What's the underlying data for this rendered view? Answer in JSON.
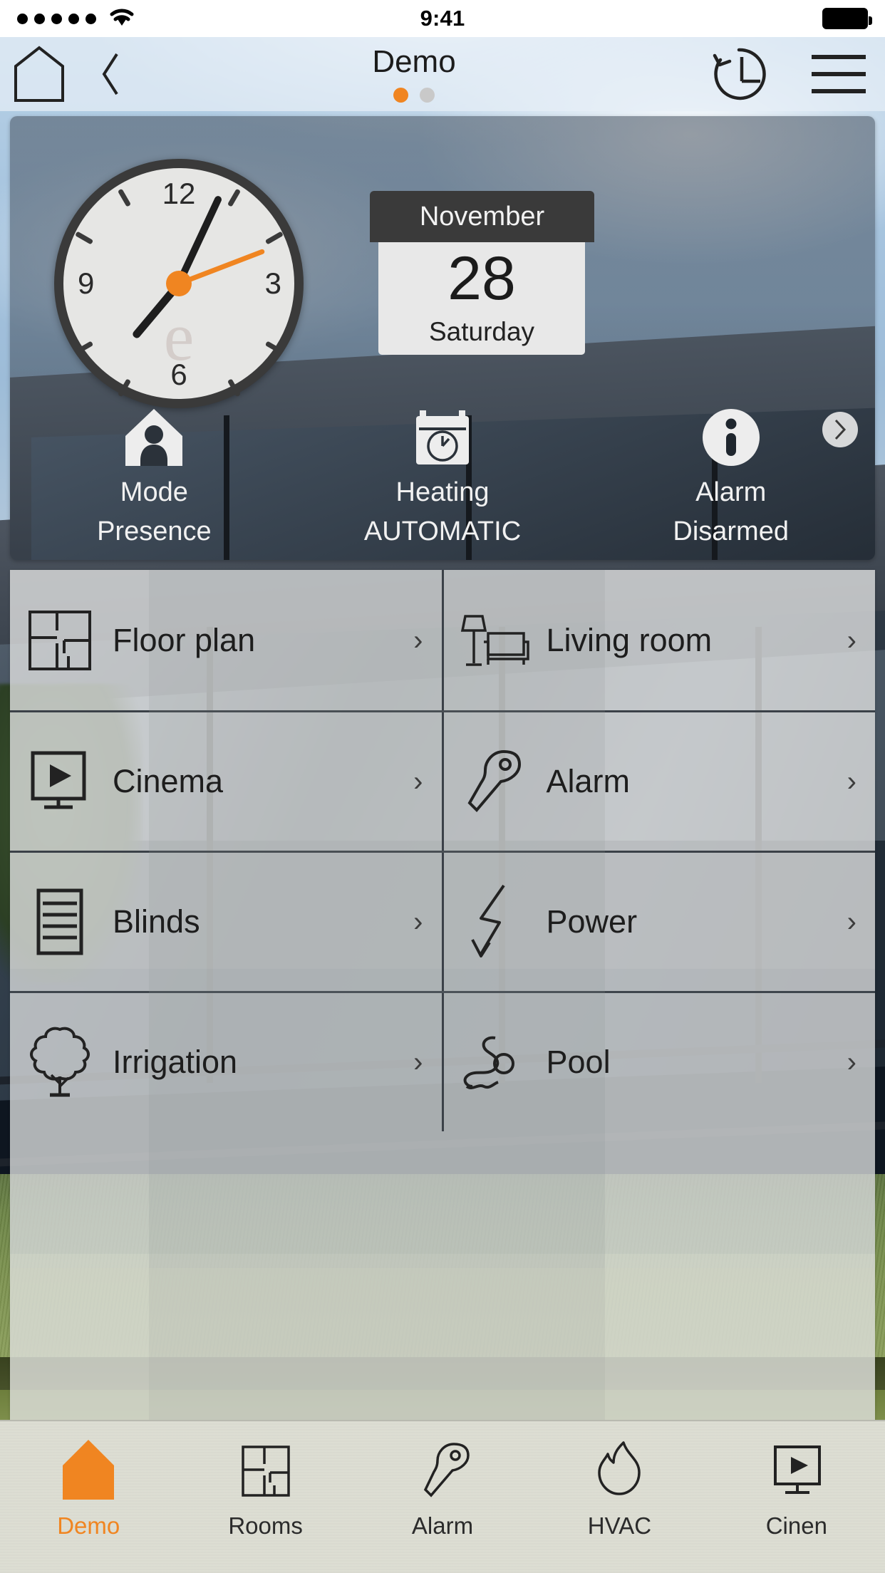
{
  "statusbar": {
    "signal_dots": 5,
    "wifi_icon": "wifi-icon",
    "time": "9:41",
    "battery_icon": "battery-full-icon"
  },
  "navbar": {
    "home_icon": "home-outline-icon",
    "back_icon": "chevron-left-icon",
    "title": "Demo",
    "page_dots": [
      {
        "active": true
      },
      {
        "active": false
      }
    ],
    "history_icon": "clock-rotate-left-icon",
    "menu_icon": "hamburger-menu-icon"
  },
  "hero": {
    "clock": {
      "numbers": {
        "n12": "12",
        "n3": "3",
        "n6": "6",
        "n9": "9"
      },
      "watermark": "e"
    },
    "calendar": {
      "month": "November",
      "day": "28",
      "weekday": "Saturday"
    },
    "status_tiles": [
      {
        "icon": "person-in-house-icon",
        "label": "Mode",
        "value": "Presence"
      },
      {
        "icon": "calendar-clock-icon",
        "label": "Heating",
        "value": "AUTOMATIC"
      },
      {
        "icon": "info-circle-icon",
        "label": "Alarm",
        "value": "Disarmed"
      }
    ],
    "next_page_icon": "chevron-right-circle-icon"
  },
  "grid": {
    "chevron": "›",
    "rows": [
      [
        {
          "icon": "floor-plan-icon",
          "label": "Floor plan"
        },
        {
          "icon": "sofa-lamp-icon",
          "label": "Living room"
        }
      ],
      [
        {
          "icon": "monitor-play-icon",
          "label": "Cinema"
        },
        {
          "icon": "key-icon",
          "label": "Alarm"
        }
      ],
      [
        {
          "icon": "blinds-icon",
          "label": "Blinds"
        },
        {
          "icon": "lightning-bolt-icon",
          "label": "Power"
        }
      ],
      [
        {
          "icon": "tree-icon",
          "label": "Irrigation"
        },
        {
          "icon": "swimmer-icon",
          "label": "Pool"
        }
      ]
    ]
  },
  "tabbar": {
    "tabs": [
      {
        "icon": "home-solid-icon",
        "label": "Demo",
        "active": true
      },
      {
        "icon": "floor-plan-icon",
        "label": "Rooms",
        "active": false
      },
      {
        "icon": "key-icon",
        "label": "Alarm",
        "active": false
      },
      {
        "icon": "flame-icon",
        "label": "HVAC",
        "active": false
      },
      {
        "icon": "monitor-play-icon",
        "label": "Cinen",
        "active": false
      }
    ]
  },
  "colors": {
    "accent": "#f08521",
    "nav_text": "#1c1c1c",
    "card_bg": "#e8e8e8",
    "cal_head_bg": "#3a3a3a",
    "tabbar_bg": "#dcddd2"
  }
}
